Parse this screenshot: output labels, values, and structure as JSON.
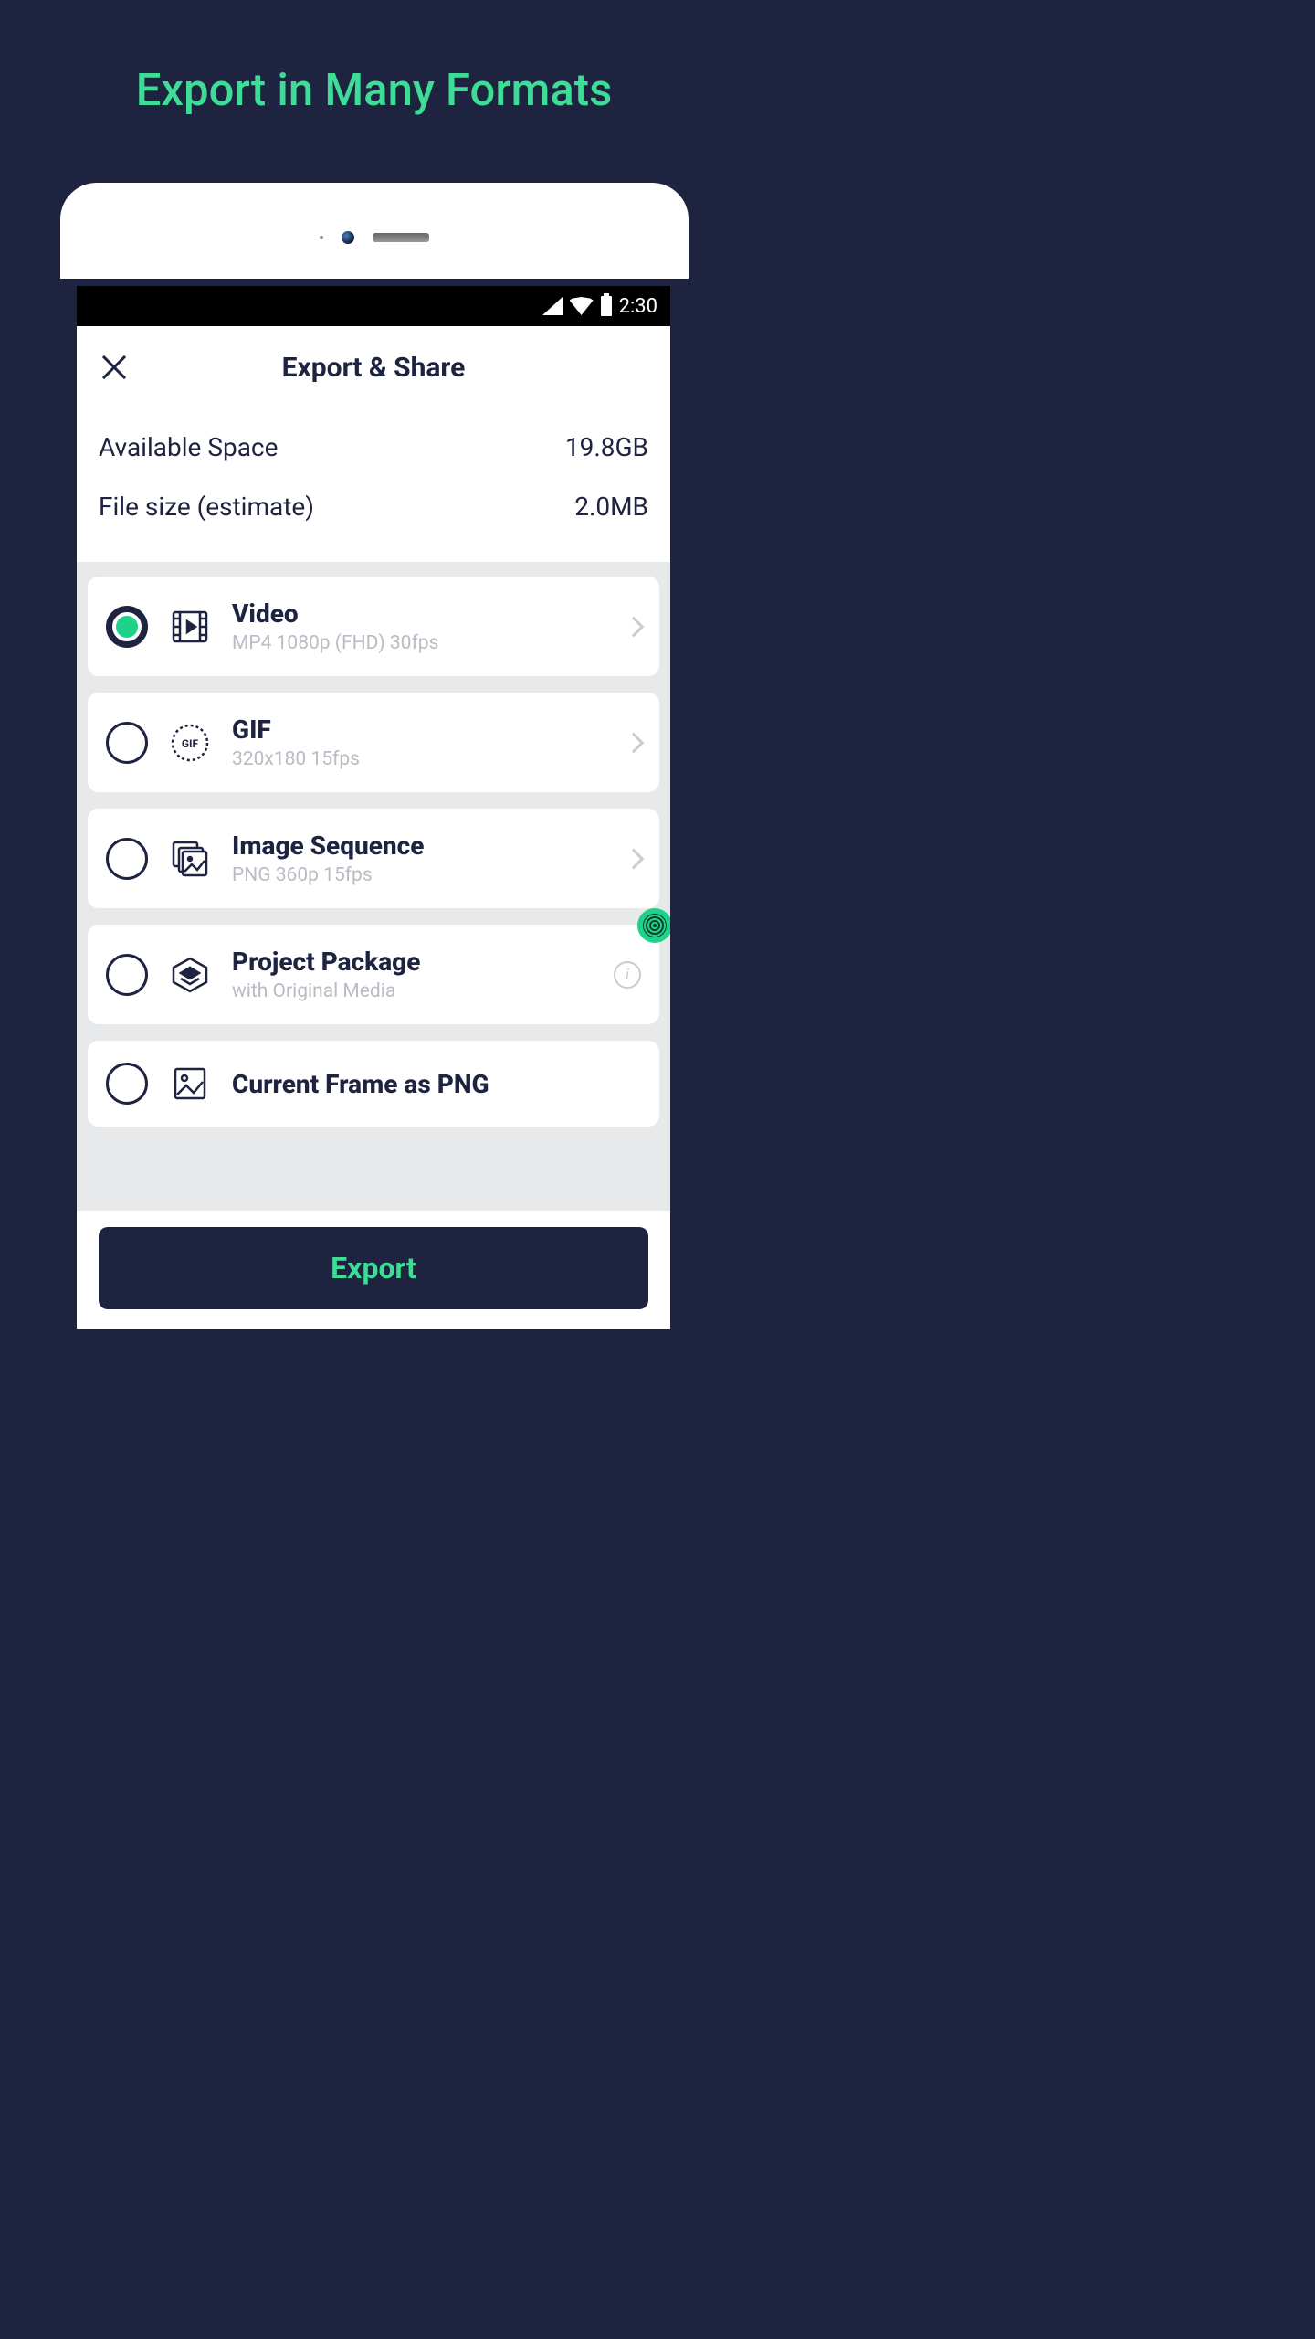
{
  "promo_title": "Export in Many Formats",
  "statusbar": {
    "time": "2:30"
  },
  "screen_title": "Export & Share",
  "info": {
    "available_label": "Available Space",
    "available_value": "19.8GB",
    "filesize_label": "File size (estimate)",
    "filesize_value": "2.0MB"
  },
  "options": [
    {
      "title": "Video",
      "sub": "MP4 1080p (FHD) 30fps",
      "selected": true,
      "trailing": "chevron"
    },
    {
      "title": "GIF",
      "sub": "320x180 15fps",
      "selected": false,
      "trailing": "chevron"
    },
    {
      "title": "Image Sequence",
      "sub": "PNG 360p 15fps",
      "selected": false,
      "trailing": "chevron"
    },
    {
      "title": "Project Package",
      "sub": "with Original Media",
      "selected": false,
      "trailing": "info",
      "badge": true
    },
    {
      "title": "Current Frame as PNG",
      "sub": "",
      "selected": false,
      "trailing": ""
    }
  ],
  "export_label": "Export"
}
